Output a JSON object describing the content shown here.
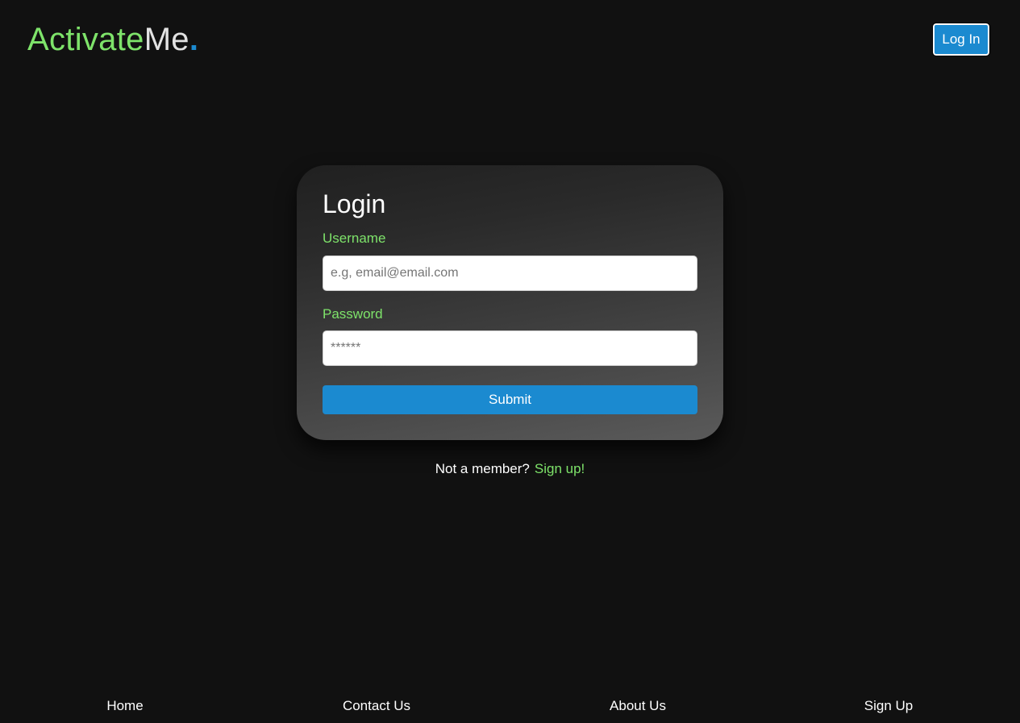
{
  "brand": {
    "part1": "Activate",
    "part2": "Me",
    "part3": ".",
    "colors": {
      "green": "#7ee36a",
      "light": "#e2e2e2",
      "blue": "#1b8ad0"
    }
  },
  "header": {
    "login_label": "Log In"
  },
  "login_form": {
    "title": "Login",
    "username_label": "Username",
    "username_placeholder": "e.g, email@email.com",
    "password_label": "Password",
    "password_placeholder": "******",
    "submit_label": "Submit"
  },
  "signup_prompt": {
    "question": "Not a member?",
    "link": "Sign up!"
  },
  "footer": {
    "links": [
      "Home",
      "Contact Us",
      "About Us",
      "Sign Up"
    ]
  },
  "theme": {
    "background": "#111111",
    "accent": "#1b8ad0",
    "highlight": "#7ee36a"
  }
}
